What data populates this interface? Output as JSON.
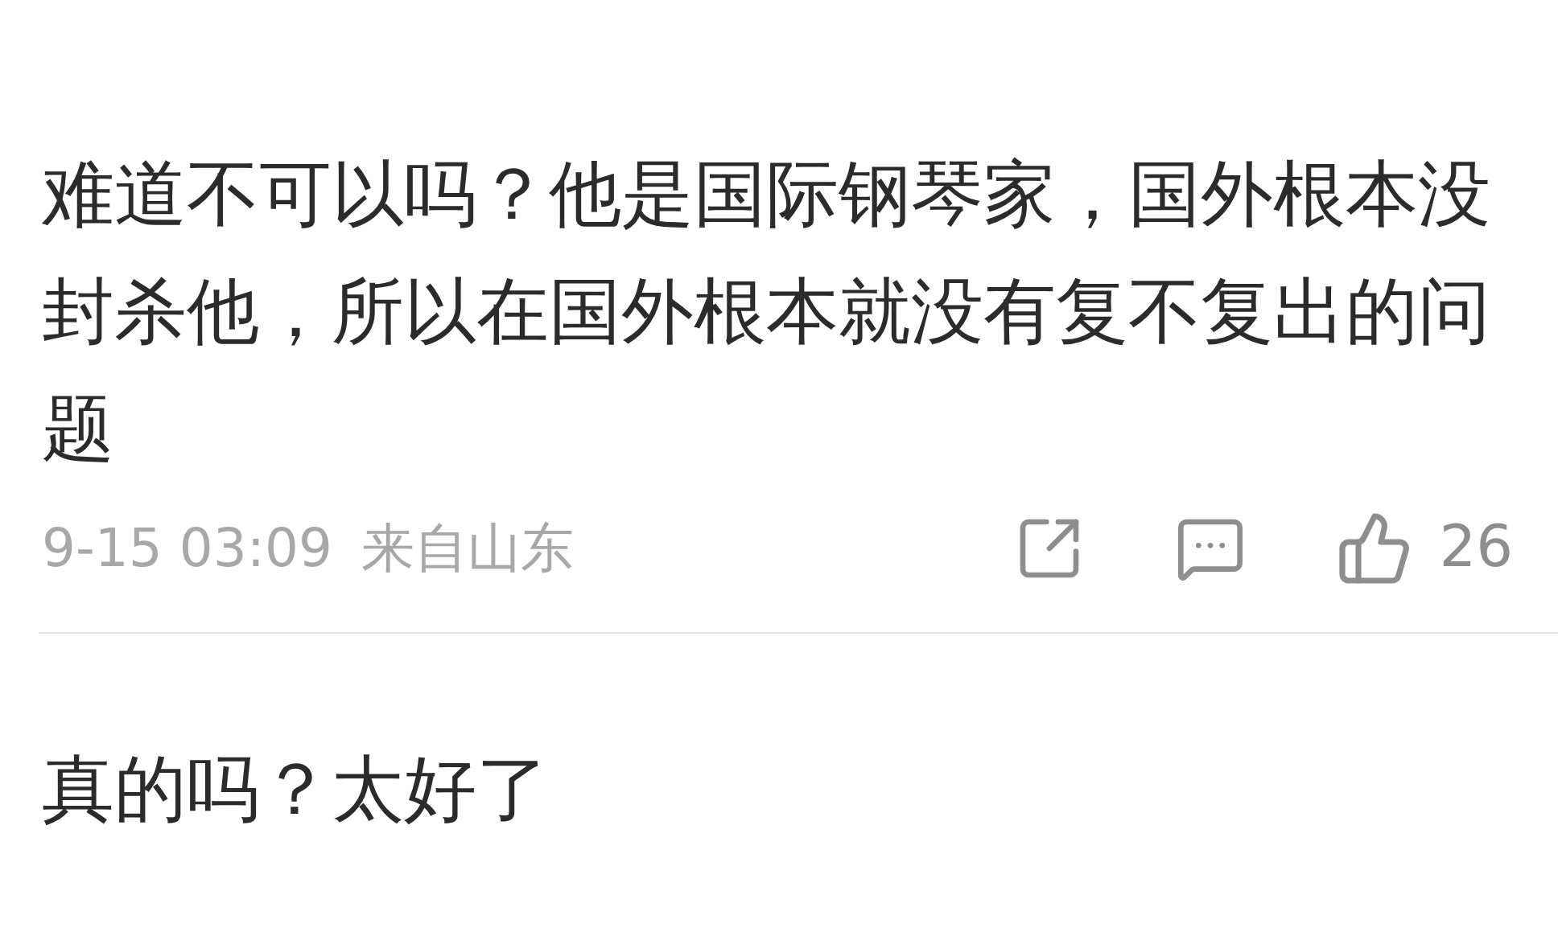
{
  "comments": [
    {
      "text": "难道不可以吗？他是国际钢琴家，国外根本没封杀他，所以在国外根本就没有复不复出的问题",
      "time": "9-15 03:09",
      "source": "来自山东",
      "likes": "26"
    },
    {
      "text": "真的吗？太好了"
    }
  ]
}
